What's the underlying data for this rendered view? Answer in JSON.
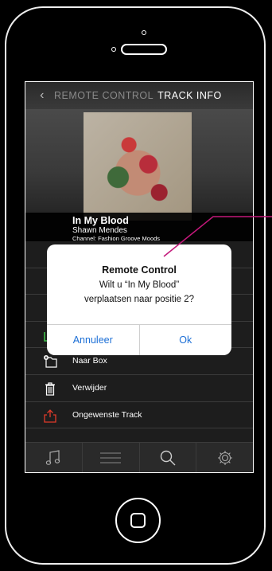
{
  "nav": {
    "back_icon": "chevron-left-icon",
    "remote_label": "REMOTE CONTROL",
    "track_label": "TRACK INFO"
  },
  "track": {
    "title": "In My Blood",
    "artist": "Shawn Mendes",
    "channel": "Channel: Fashion Groove Moods"
  },
  "menu": {
    "items": [
      {
        "label": "",
        "icon": "hidden-icon"
      },
      {
        "label": "",
        "icon": "hidden-icon"
      },
      {
        "label": "",
        "icon": "hidden-icon"
      },
      {
        "label": "",
        "icon": "hidden-icon"
      },
      {
        "label": "Naar Box",
        "icon": "folder-add-icon"
      },
      {
        "label": "Verwijder",
        "icon": "trash-icon"
      },
      {
        "label": "Ongewenste Track",
        "icon": "share-export-icon"
      }
    ]
  },
  "dialog": {
    "title": "Remote Control",
    "line1": "Wilt u “In My Blood”",
    "line2": "verplaatsen naar positie 2?",
    "cancel": "Annuleer",
    "ok": "Ok"
  },
  "tabs": [
    {
      "icon": "music-note-icon"
    },
    {
      "icon": "list-icon"
    },
    {
      "icon": "search-icon"
    },
    {
      "icon": "gear-icon"
    }
  ],
  "colors": {
    "accent_blue": "#1c6fd6",
    "danger_red": "#e03a2a",
    "annotation_magenta": "#c2187a"
  }
}
